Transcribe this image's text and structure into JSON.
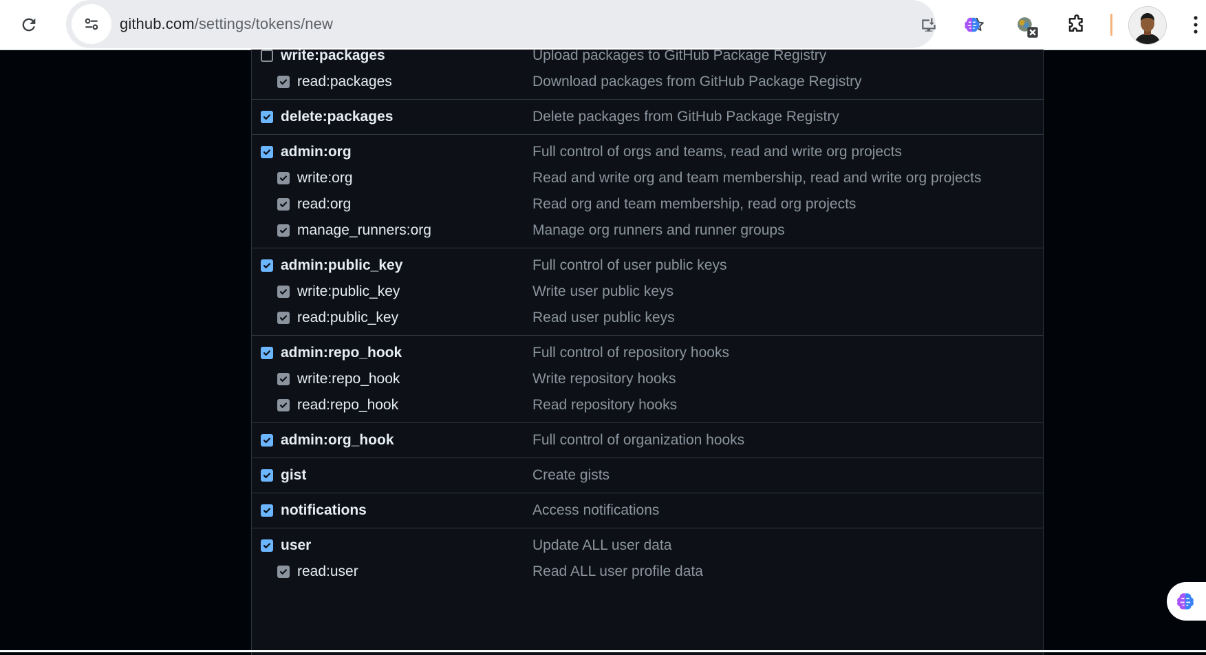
{
  "browser": {
    "url_host": "github.com",
    "url_path": "/settings/tokens/new",
    "icons": {
      "reload": "reload-icon",
      "site_info": "tune-icon",
      "install": "install-app-icon",
      "bookmark": "star-icon",
      "extensions": [
        "brain-extension-icon",
        "x-extension-icon",
        "puzzle-extension-icon"
      ],
      "menu": "kebab-menu-icon"
    }
  },
  "colors": {
    "page_bg": "#010409",
    "panel_bg": "#0d1117",
    "border": "#30363d",
    "checkbox_checked": "#6cb6ff",
    "text": "#e6edf3",
    "muted": "#8b949e"
  },
  "scope_groups": [
    {
      "items": [
        {
          "scope": "write:packages",
          "desc": "Upload packages to GitHub Package Registry",
          "level": "parent",
          "state": "unchecked"
        },
        {
          "scope": "read:packages",
          "desc": "Download packages from GitHub Package Registry",
          "level": "child",
          "state": "implied"
        }
      ]
    },
    {
      "items": [
        {
          "scope": "delete:packages",
          "desc": "Delete packages from GitHub Package Registry",
          "level": "parent",
          "state": "checked"
        }
      ]
    },
    {
      "items": [
        {
          "scope": "admin:org",
          "desc": "Full control of orgs and teams, read and write org projects",
          "level": "parent",
          "state": "checked"
        },
        {
          "scope": "write:org",
          "desc": "Read and write org and team membership, read and write org projects",
          "level": "child",
          "state": "implied"
        },
        {
          "scope": "read:org",
          "desc": "Read org and team membership, read org projects",
          "level": "child",
          "state": "implied"
        },
        {
          "scope": "manage_runners:org",
          "desc": "Manage org runners and runner groups",
          "level": "child",
          "state": "implied"
        }
      ]
    },
    {
      "items": [
        {
          "scope": "admin:public_key",
          "desc": "Full control of user public keys",
          "level": "parent",
          "state": "checked"
        },
        {
          "scope": "write:public_key",
          "desc": "Write user public keys",
          "level": "child",
          "state": "implied"
        },
        {
          "scope": "read:public_key",
          "desc": "Read user public keys",
          "level": "child",
          "state": "implied"
        }
      ]
    },
    {
      "items": [
        {
          "scope": "admin:repo_hook",
          "desc": "Full control of repository hooks",
          "level": "parent",
          "state": "checked"
        },
        {
          "scope": "write:repo_hook",
          "desc": "Write repository hooks",
          "level": "child",
          "state": "implied"
        },
        {
          "scope": "read:repo_hook",
          "desc": "Read repository hooks",
          "level": "child",
          "state": "implied"
        }
      ]
    },
    {
      "items": [
        {
          "scope": "admin:org_hook",
          "desc": "Full control of organization hooks",
          "level": "parent",
          "state": "checked"
        }
      ]
    },
    {
      "items": [
        {
          "scope": "gist",
          "desc": "Create gists",
          "level": "parent",
          "state": "checked"
        }
      ]
    },
    {
      "items": [
        {
          "scope": "notifications",
          "desc": "Access notifications",
          "level": "parent",
          "state": "checked"
        }
      ]
    },
    {
      "items": [
        {
          "scope": "user",
          "desc": "Update ALL user data",
          "level": "parent",
          "state": "checked"
        },
        {
          "scope": "read:user",
          "desc": "Read ALL user profile data",
          "level": "child",
          "state": "implied"
        }
      ]
    }
  ],
  "floating_button": {
    "icon": "brain-assistant-icon"
  }
}
